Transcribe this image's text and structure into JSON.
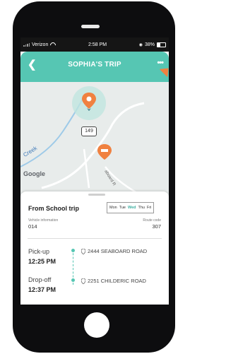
{
  "status_bar": {
    "carrier": "Verizon",
    "time": "2:58 PM",
    "battery": "38%",
    "battery_level": 0.38
  },
  "header": {
    "back_icon": "chevron-left-icon",
    "title": "SOPHIA'S TRIP",
    "menu_icon": "more-dots-icon"
  },
  "map": {
    "road_sign": "149",
    "creek_label": "Creek",
    "road_label": "aboard R",
    "google_logo": "Google",
    "colors": {
      "water": "#9ecae8",
      "accent": "#f08140",
      "teal": "#56c6b3"
    }
  },
  "trip": {
    "title": "From School trip",
    "days": [
      {
        "label": "Mon",
        "active": false
      },
      {
        "label": "Tue",
        "active": false
      },
      {
        "label": "Wed",
        "active": true
      },
      {
        "label": "Thu",
        "active": false
      },
      {
        "label": "Fri",
        "active": false
      }
    ],
    "vehicle_label": "Vehicle information",
    "vehicle_value": "014",
    "route_label": "Route code",
    "route_value": "307",
    "stops": [
      {
        "type": "Pick-up",
        "time": "12:25 PM",
        "address": "2444 SEABOARD ROAD"
      },
      {
        "type": "Drop-off",
        "time": "12:37 PM",
        "address": "2251 CHILDERIC ROAD"
      }
    ]
  }
}
